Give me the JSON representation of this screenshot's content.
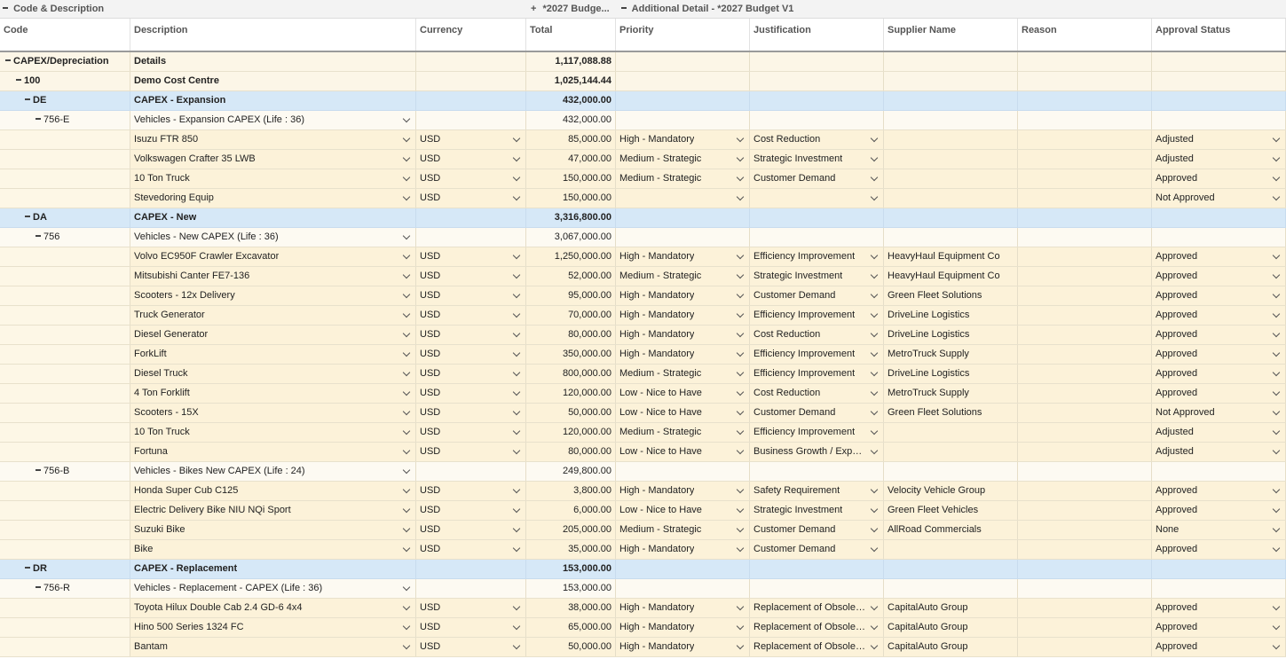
{
  "band": {
    "code_desc": "Code & Description",
    "budget_group": "*2027 Budge...",
    "additional": "Additional Detail - *2027 Budget V1"
  },
  "headers": [
    "Code",
    "Description",
    "Currency",
    "Total",
    "Priority",
    "Justification",
    "Supplier Name",
    "Reason",
    "Approval Status"
  ],
  "colors": {
    "blue_row": "#d6e8f7",
    "item_row": "#fcf2d9",
    "header_rule": "#9a9a9a"
  },
  "rows": [
    {
      "type": "group",
      "level": 0,
      "code": "CAPEX/Depreciation",
      "desc": "Details",
      "total": "1,117,088.88"
    },
    {
      "type": "group",
      "level": 1,
      "code": "100",
      "desc": "Demo Cost Centre",
      "total": "1,025,144.44"
    },
    {
      "type": "blue",
      "level": 2,
      "code": "DE",
      "desc": "CAPEX - Expansion",
      "total": "432,000.00"
    },
    {
      "type": "sub",
      "level": 3,
      "code": "756-E",
      "desc": "Vehicles - Expansion CAPEX (Life : 36)",
      "total": "432,000.00"
    },
    {
      "type": "item",
      "desc": "Isuzu FTR 850",
      "currency": "USD",
      "total": "85,000.00",
      "priority": "High - Mandatory",
      "justification": "Cost Reduction",
      "supplier": "",
      "reason": "",
      "approval": "Adjusted"
    },
    {
      "type": "item",
      "desc": "Volkswagen Crafter 35 LWB",
      "currency": "USD",
      "total": "47,000.00",
      "priority": "Medium - Strategic",
      "justification": "Strategic Investment",
      "supplier": "",
      "reason": "",
      "approval": "Adjusted"
    },
    {
      "type": "item",
      "desc": "10 Ton Truck",
      "currency": "USD",
      "total": "150,000.00",
      "priority": "Medium - Strategic",
      "justification": "Customer Demand",
      "supplier": "",
      "reason": "",
      "approval": "Approved"
    },
    {
      "type": "item",
      "desc": "Stevedoring Equip",
      "currency": "USD",
      "total": "150,000.00",
      "priority": "",
      "justification": "",
      "supplier": "",
      "reason": "",
      "approval": "Not Approved"
    },
    {
      "type": "blue",
      "level": 2,
      "code": "DA",
      "desc": "CAPEX - New",
      "total": "3,316,800.00"
    },
    {
      "type": "sub",
      "level": 3,
      "code": "756",
      "desc": "Vehicles - New CAPEX (Life : 36)",
      "total": "3,067,000.00"
    },
    {
      "type": "item",
      "desc": "Volvo EC950F Crawler Excavator",
      "currency": "USD",
      "total": "1,250,000.00",
      "priority": "High - Mandatory",
      "justification": "Efficiency Improvement",
      "supplier": "HeavyHaul Equipment Co",
      "reason": "",
      "approval": "Approved"
    },
    {
      "type": "item",
      "desc": "Mitsubishi Canter FE7-136",
      "currency": "USD",
      "total": "52,000.00",
      "priority": "Medium - Strategic",
      "justification": "Strategic Investment",
      "supplier": "HeavyHaul Equipment Co",
      "reason": "",
      "approval": "Approved"
    },
    {
      "type": "item",
      "desc": "Scooters - 12x Delivery",
      "currency": "USD",
      "total": "95,000.00",
      "priority": "High - Mandatory",
      "justification": "Customer Demand",
      "supplier": "Green Fleet Solutions",
      "reason": "",
      "approval": "Approved"
    },
    {
      "type": "item",
      "desc": "Truck Generator",
      "currency": "USD",
      "total": "70,000.00",
      "priority": "High - Mandatory",
      "justification": "Efficiency Improvement",
      "supplier": "DriveLine Logistics",
      "reason": "",
      "approval": "Approved"
    },
    {
      "type": "item",
      "desc": "Diesel Generator",
      "currency": "USD",
      "total": "80,000.00",
      "priority": "High - Mandatory",
      "justification": "Cost Reduction",
      "supplier": "DriveLine Logistics",
      "reason": "",
      "approval": "Approved"
    },
    {
      "type": "item",
      "desc": "ForkLift",
      "currency": "USD",
      "total": "350,000.00",
      "priority": "High - Mandatory",
      "justification": "Efficiency Improvement",
      "supplier": "MetroTruck Supply",
      "reason": "",
      "approval": "Approved"
    },
    {
      "type": "item",
      "desc": "Diesel Truck",
      "currency": "USD",
      "total": "800,000.00",
      "priority": "Medium - Strategic",
      "justification": "Efficiency Improvement",
      "supplier": "DriveLine Logistics",
      "reason": "",
      "approval": "Approved"
    },
    {
      "type": "item",
      "desc": "4 Ton Forklift",
      "currency": "USD",
      "total": "120,000.00",
      "priority": "Low - Nice to Have",
      "justification": "Cost Reduction",
      "supplier": "MetroTruck Supply",
      "reason": "",
      "approval": "Approved"
    },
    {
      "type": "item",
      "desc": "Scooters - 15X",
      "currency": "USD",
      "total": "50,000.00",
      "priority": "Low - Nice to Have",
      "justification": "Customer Demand",
      "supplier": "Green Fleet Solutions",
      "reason": "",
      "approval": "Not Approved"
    },
    {
      "type": "item",
      "desc": "10 Ton Truck",
      "currency": "USD",
      "total": "120,000.00",
      "priority": "Medium - Strategic",
      "justification": "Efficiency Improvement",
      "supplier": "",
      "reason": "",
      "approval": "Adjusted"
    },
    {
      "type": "item",
      "desc": "Fortuna",
      "currency": "USD",
      "total": "80,000.00",
      "priority": "Low - Nice to Have",
      "justification": "Business Growth / Expan...",
      "supplier": "",
      "reason": "",
      "approval": "Adjusted"
    },
    {
      "type": "sub",
      "level": 3,
      "code": "756-B",
      "desc": "Vehicles - Bikes New CAPEX (Life : 24)",
      "total": "249,800.00"
    },
    {
      "type": "item",
      "desc": "Honda Super Cub  C125",
      "currency": "USD",
      "total": "3,800.00",
      "priority": "High - Mandatory",
      "justification": "Safety Requirement",
      "supplier": "Velocity Vehicle Group",
      "reason": "",
      "approval": "Approved"
    },
    {
      "type": "item",
      "desc": "Electric Delivery Bike NIU NQi Sport",
      "currency": "USD",
      "total": "6,000.00",
      "priority": "Low - Nice to Have",
      "justification": "Strategic Investment",
      "supplier": "Green Fleet Vehicles",
      "reason": "",
      "approval": "Approved"
    },
    {
      "type": "item",
      "desc": "Suzuki Bike",
      "currency": "USD",
      "total": "205,000.00",
      "priority": "Medium - Strategic",
      "justification": "Customer Demand",
      "supplier": "AllRoad Commercials",
      "reason": "",
      "approval": "None"
    },
    {
      "type": "item",
      "desc": "Bike",
      "currency": "USD",
      "total": "35,000.00",
      "priority": "High - Mandatory",
      "justification": "Customer Demand",
      "supplier": "",
      "reason": "",
      "approval": "Approved"
    },
    {
      "type": "blue",
      "level": 2,
      "code": "DR",
      "desc": "CAPEX - Replacement",
      "total": "153,000.00"
    },
    {
      "type": "sub",
      "level": 3,
      "code": "756-R",
      "desc": "Vehicles - Replacement - CAPEX (Life : 36)",
      "total": "153,000.00"
    },
    {
      "type": "item",
      "desc": "Toyota Hilux Double Cab 2.4 GD-6 4x4",
      "currency": "USD",
      "total": "38,000.00",
      "priority": "High - Mandatory",
      "justification": "Replacement of Obsolet...",
      "supplier": "CapitalAuto Group",
      "reason": "",
      "approval": "Approved"
    },
    {
      "type": "item",
      "desc": "Hino 500 Series 1324 FC",
      "currency": "USD",
      "total": "65,000.00",
      "priority": "High - Mandatory",
      "justification": "Replacement of Obsolet...",
      "supplier": "CapitalAuto Group",
      "reason": "",
      "approval": "Approved"
    },
    {
      "type": "item",
      "desc": "Bantam",
      "currency": "USD",
      "total": "50,000.00",
      "priority": "High - Mandatory",
      "justification": "Replacement of Obsolet...",
      "supplier": "CapitalAuto Group",
      "reason": "",
      "approval": "Approved"
    }
  ]
}
